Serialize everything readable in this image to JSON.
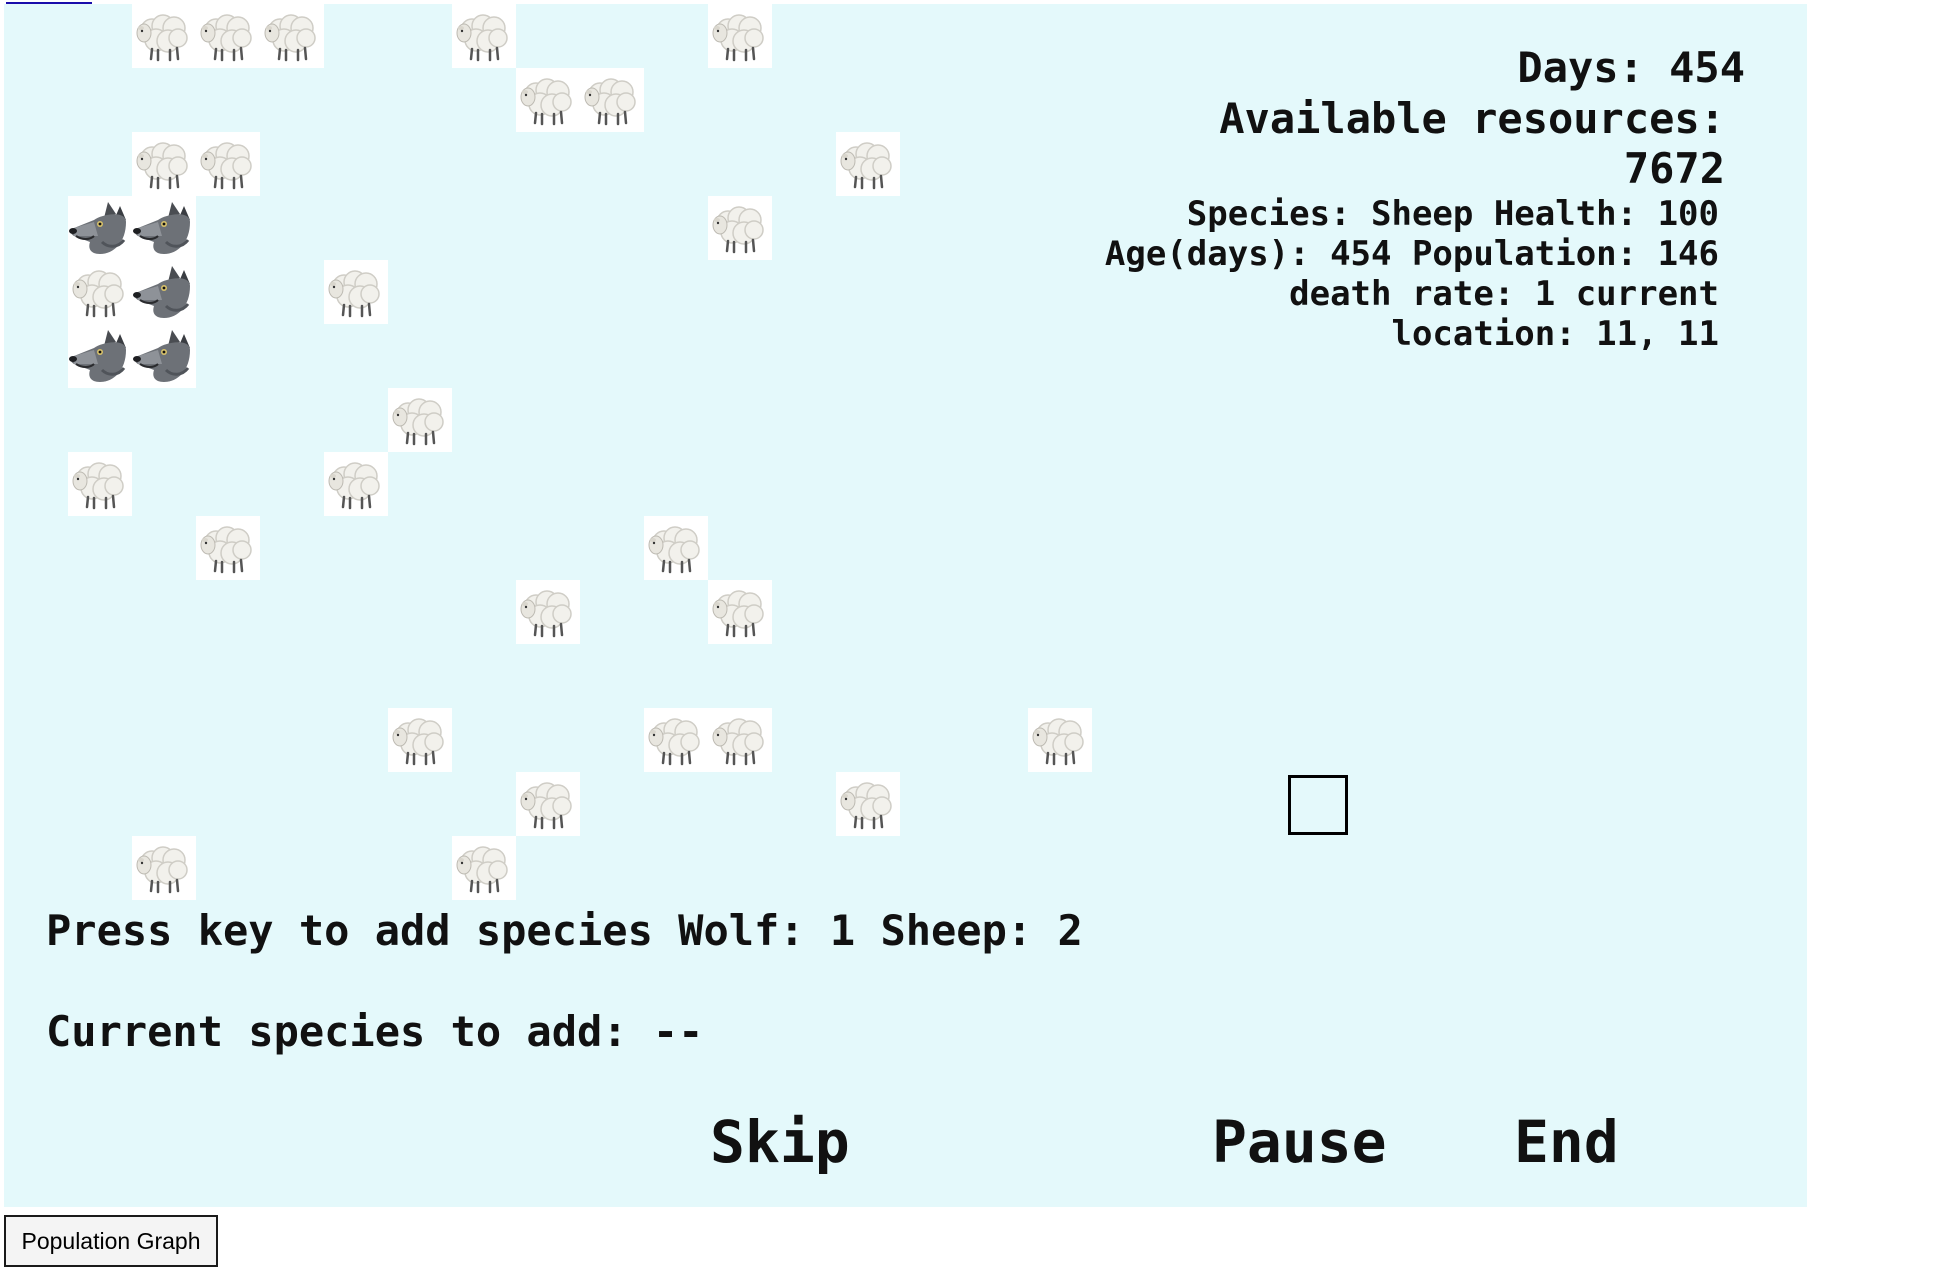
{
  "stats": {
    "days": "Days: 454",
    "resources": "Available resources: 7672",
    "species_info": "Species: Sheep Health: 100 Age(days): 454 Population: 146 death rate: 1 current location: 11, 11"
  },
  "prompt": "Press key to add species Wolf: 1 Sheep: 2",
  "current_species": "Current species to add: --",
  "controls": {
    "skip": "Skip",
    "pause": "Pause",
    "end": "End"
  },
  "population_graph_button": "Population Graph",
  "grid": {
    "cell_units": 64,
    "cursor": {
      "col": 20,
      "row": 12
    },
    "animals": [
      {
        "species": "sheep",
        "col": 2,
        "row": 0
      },
      {
        "species": "sheep",
        "col": 3,
        "row": 0
      },
      {
        "species": "sheep",
        "col": 4,
        "row": 0
      },
      {
        "species": "sheep",
        "col": 7,
        "row": 0
      },
      {
        "species": "sheep",
        "col": 11,
        "row": 0
      },
      {
        "species": "sheep",
        "col": 8,
        "row": 1
      },
      {
        "species": "sheep",
        "col": 9,
        "row": 1
      },
      {
        "species": "sheep",
        "col": 2,
        "row": 2
      },
      {
        "species": "sheep",
        "col": 3,
        "row": 2
      },
      {
        "species": "sheep",
        "col": 13,
        "row": 2
      },
      {
        "species": "wolf",
        "col": 1,
        "row": 3
      },
      {
        "species": "wolf",
        "col": 2,
        "row": 3
      },
      {
        "species": "sheep",
        "col": 11,
        "row": 3
      },
      {
        "species": "sheep",
        "col": 1,
        "row": 4
      },
      {
        "species": "wolf",
        "col": 2,
        "row": 4
      },
      {
        "species": "sheep",
        "col": 5,
        "row": 4
      },
      {
        "species": "wolf",
        "col": 1,
        "row": 5
      },
      {
        "species": "wolf",
        "col": 2,
        "row": 5
      },
      {
        "species": "sheep",
        "col": 6,
        "row": 6
      },
      {
        "species": "sheep",
        "col": 1,
        "row": 7
      },
      {
        "species": "sheep",
        "col": 5,
        "row": 7
      },
      {
        "species": "sheep",
        "col": 3,
        "row": 8
      },
      {
        "species": "sheep",
        "col": 10,
        "row": 8
      },
      {
        "species": "sheep",
        "col": 8,
        "row": 9
      },
      {
        "species": "sheep",
        "col": 11,
        "row": 9
      },
      {
        "species": "sheep",
        "col": 6,
        "row": 11
      },
      {
        "species": "sheep",
        "col": 10,
        "row": 11
      },
      {
        "species": "sheep",
        "col": 11,
        "row": 11
      },
      {
        "species": "sheep",
        "col": 16,
        "row": 11
      },
      {
        "species": "sheep",
        "col": 8,
        "row": 12
      },
      {
        "species": "sheep",
        "col": 13,
        "row": 12
      },
      {
        "species": "sheep",
        "col": 2,
        "row": 13
      },
      {
        "species": "sheep",
        "col": 7,
        "row": 13
      }
    ]
  }
}
